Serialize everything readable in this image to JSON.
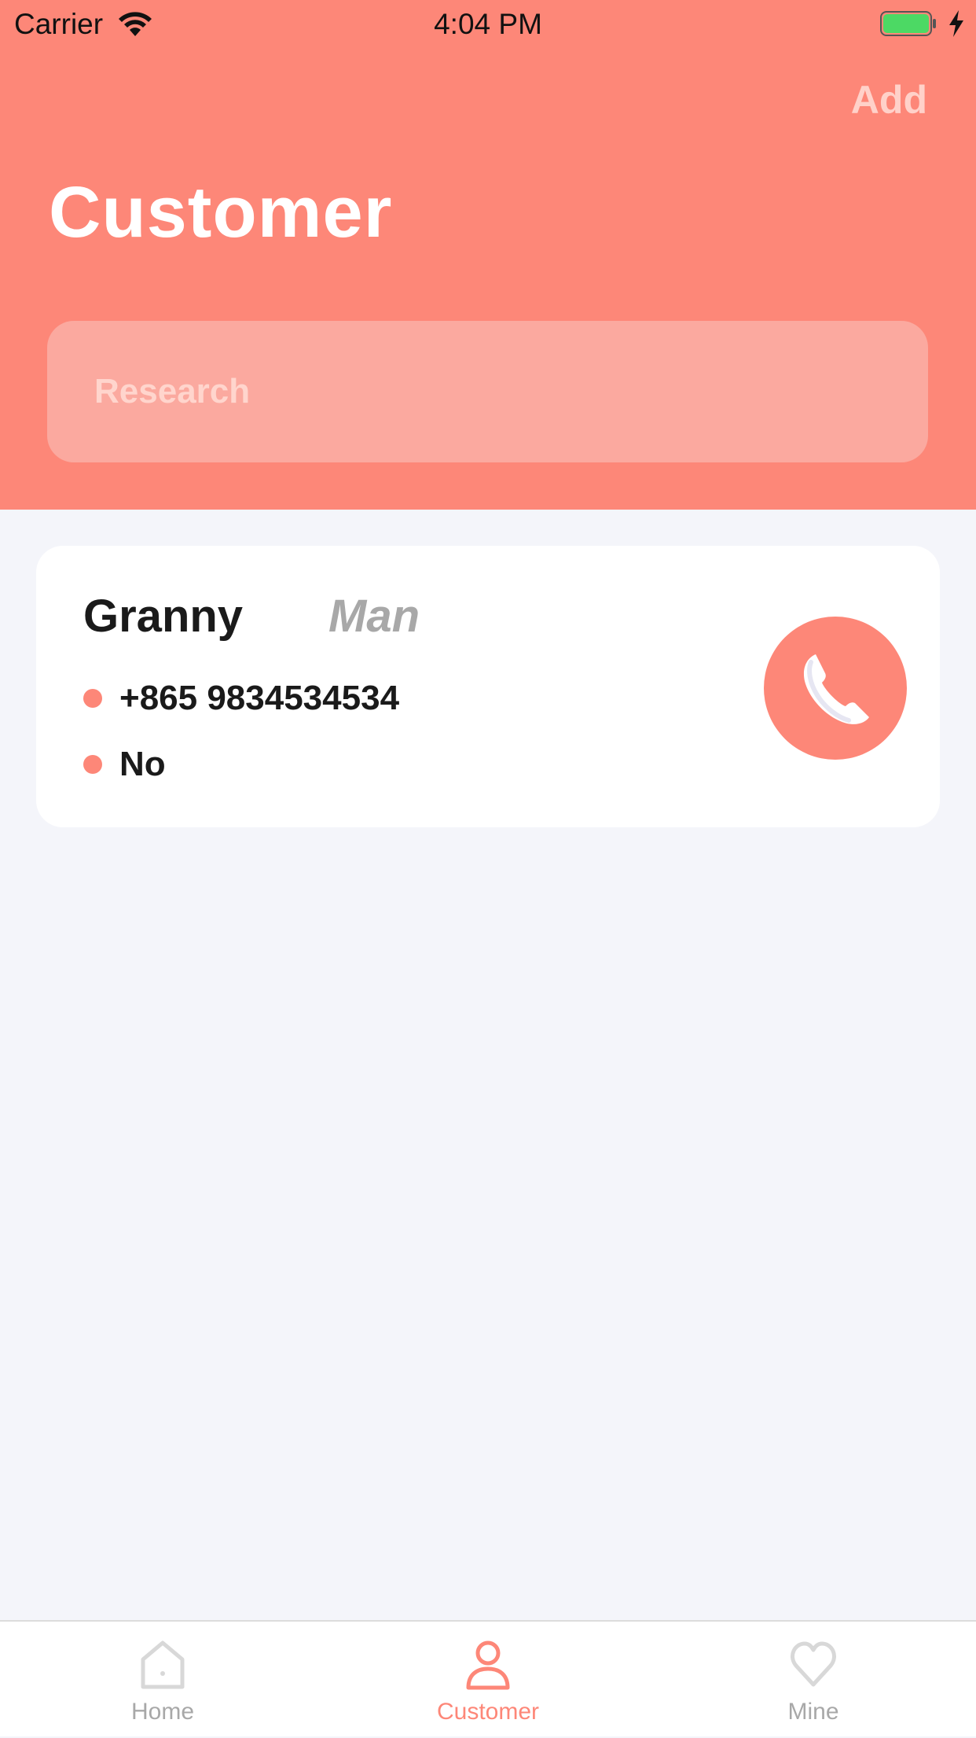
{
  "status_bar": {
    "carrier": "Carrier",
    "time": "4:04 PM",
    "battery_color": "#4cd964"
  },
  "header": {
    "add_label": "Add",
    "title": "Customer",
    "search_placeholder": "Research",
    "background_color": "#fd8778"
  },
  "customers": [
    {
      "name": "Granny",
      "gender": "Man",
      "phone": "+865 9834534534",
      "note": "No",
      "call_icon": "phone-icon"
    }
  ],
  "tab_bar": {
    "tabs": [
      {
        "label": "Home",
        "icon": "home-icon",
        "active": false
      },
      {
        "label": "Customer",
        "icon": "person-icon",
        "active": true
      },
      {
        "label": "Mine",
        "icon": "heart-icon",
        "active": false
      }
    ]
  },
  "colors": {
    "accent": "#fd8778",
    "page_background": "#f4f5fa",
    "inactive_tab": "#a8a8a8"
  }
}
